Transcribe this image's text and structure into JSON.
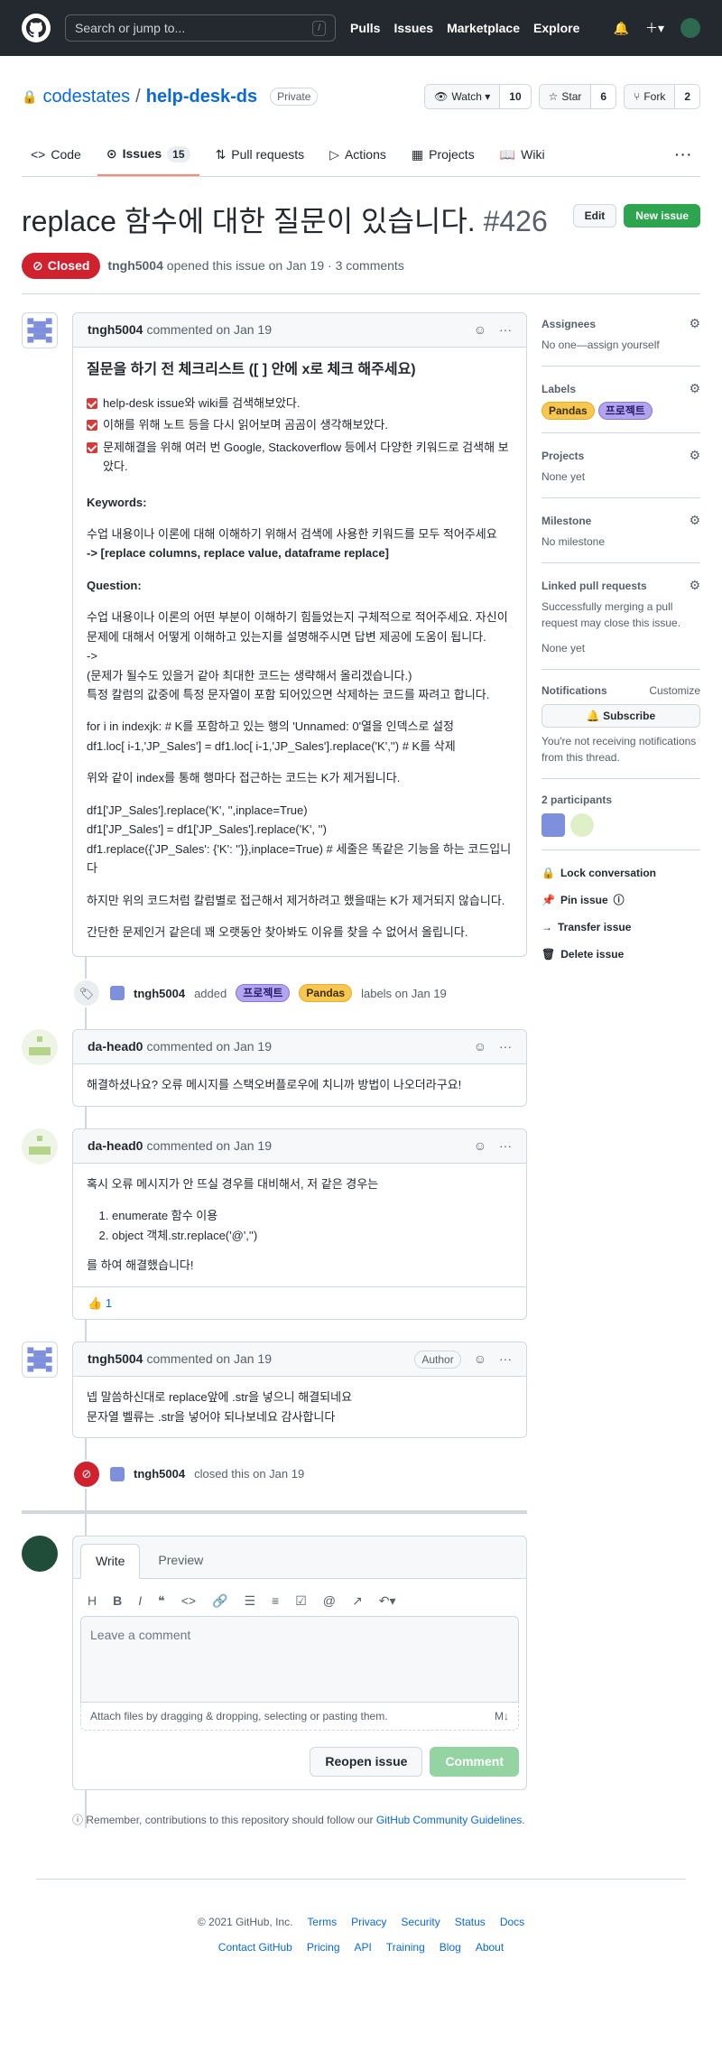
{
  "header": {
    "search_placeholder": "Search or jump to...",
    "nav": [
      "Pulls",
      "Issues",
      "Marketplace",
      "Explore"
    ]
  },
  "repo": {
    "owner": "codestates",
    "name": "help-desk-ds",
    "visibility": "Private",
    "watch_label": "Watch",
    "watch_count": "10",
    "star_label": "Star",
    "star_count": "6",
    "fork_label": "Fork",
    "fork_count": "2"
  },
  "tabs": {
    "code": "Code",
    "issues": "Issues",
    "issues_count": "15",
    "pulls": "Pull requests",
    "actions": "Actions",
    "projects": "Projects",
    "wiki": "Wiki"
  },
  "issue": {
    "title": "replace 함수에 대한 질문이 있습니다.",
    "number": "#426",
    "edit": "Edit",
    "new_issue": "New issue",
    "state": "Closed",
    "author": "tngh5004",
    "meta": "opened this issue on Jan 19 · 3 comments"
  },
  "comment1": {
    "author": "tngh5004",
    "time": "commented on Jan 19",
    "heading": "질문을 하기 전 체크리스트 ([ ] 안에 x로 체크 해주세요)",
    "tasks": [
      "help-desk issue와 wiki를 검색해보았다.",
      "이해를 위해 노트 등을 다시 읽어보며 곰곰이 생각해보았다.",
      "문제해결을 위해 여러 번 Google, Stackoverflow 등에서 다양한 키워드로 검색해 보았다."
    ],
    "kw_h": "Keywords:",
    "kw_text": "수업 내용이나 이론에 대해 이해하기 위해서 검색에 사용한 키워드를 모두 적어주세요",
    "kw_bold": "-> [replace columns, replace value, dataframe replace]",
    "q_h": "Question:",
    "q1": "수업 내용이나 이론의 어떤 부분이 이해하기 힘들었는지 구체적으로 적어주세요. 자신이 문제에 대해서 어떻게 이해하고 있는지를 설명해주시면 답변 제공에 도움이 됩니다.",
    "q2": "->",
    "q3": "(문제가 될수도 있을거 같아 최대한 코드는 생략해서 올리겠습니다.)",
    "q4": "특정 칼럼의 값중에 특정 문자열이 포함 되어있으면 삭제하는 코드를 짜려고 합니다.",
    "c1": "for i in indexjk: # K를 포함하고 있는 행의 'Unnamed: 0'열을 인덱스로 설정",
    "c2": "df1.loc[ i-1,'JP_Sales'] = df1.loc[ i-1,'JP_Sales'].replace('K','') # K를 삭제",
    "p2": "위와 같이 index를 통해 행마다 접근하는 코드는 K가 제거됩니다.",
    "d1": "df1['JP_Sales'].replace('K', '',inplace=True)",
    "d2": "df1['JP_Sales'] = df1['JP_Sales'].replace('K', '')",
    "d3": "df1.replace({'JP_Sales': {'K': ''}},inplace=True) # 세줄은 똑같은 기능을 하는 코드입니다",
    "p3": "하지만 위의 코드처럼 칼럼별로 접근해서 제거하려고 했을때는 K가 제거되지 않습니다.",
    "p4": "간단한 문제인거 같은데 꽤 오랫동안 찾아봐도 이유를 찾을 수 없어서 올립니다."
  },
  "event_label": {
    "author": "tngh5004",
    "added": "added",
    "l1": "프로젝트",
    "l2": "Pandas",
    "tail": "labels on Jan 19"
  },
  "comment2": {
    "author": "da-head0",
    "time": "commented on Jan 19",
    "text": "해결하셨나요? 오류 메시지를 스택오버플로우에 치니까 방법이 나오더라구요!"
  },
  "comment3": {
    "author": "da-head0",
    "time": "commented on Jan 19",
    "intro": "혹시 오류 메시지가 안 뜨실 경우를 대비해서, 저 같은 경우는",
    "items": [
      "enumerate 함수 이용",
      "object 객체.str.replace('@','')"
    ],
    "outro": "를 하여 해결했습니다!",
    "reaction": "👍",
    "reaction_count": "1"
  },
  "comment4": {
    "author": "tngh5004",
    "time": "commented on Jan 19",
    "badge": "Author",
    "l1": "넵 말씀하신대로 replace앞에 .str을 넣으니 해결되네요",
    "l2": "문자열 벨류는 .str을 넣어야 되나보네요 감사합니다"
  },
  "event_close": {
    "author": "tngh5004",
    "text": "closed this on Jan 19"
  },
  "editor": {
    "write": "Write",
    "preview": "Preview",
    "placeholder": "Leave a comment",
    "attach": "Attach files by dragging & dropping, selecting or pasting them.",
    "reopen": "Reopen issue",
    "comment": "Comment",
    "note_a": "Remember, contributions to this repository should follow our ",
    "note_link": "GitHub Community Guidelines",
    "note_b": "."
  },
  "sidebar": {
    "assignees_h": "Assignees",
    "assignees_v": "No one—assign yourself",
    "labels_h": "Labels",
    "label1": "Pandas",
    "label2": "프로젝트",
    "projects_h": "Projects",
    "projects_v": "None yet",
    "milestone_h": "Milestone",
    "milestone_v": "No milestone",
    "linked_h": "Linked pull requests",
    "linked_desc": "Successfully merging a pull request may close this issue.",
    "linked_v": "None yet",
    "notif_h": "Notifications",
    "customize": "Customize",
    "subscribe": "Subscribe",
    "notif_desc": "You're not receiving notifications from this thread.",
    "participants": "2 participants",
    "lock": "Lock conversation",
    "pin": "Pin issue",
    "transfer": "Transfer issue",
    "delete": "Delete issue"
  },
  "footer": {
    "copy": "© 2021 GitHub, Inc.",
    "row1": [
      "Terms",
      "Privacy",
      "Security",
      "Status",
      "Docs"
    ],
    "row2": [
      "Contact GitHub",
      "Pricing",
      "API",
      "Training",
      "Blog",
      "About"
    ]
  }
}
